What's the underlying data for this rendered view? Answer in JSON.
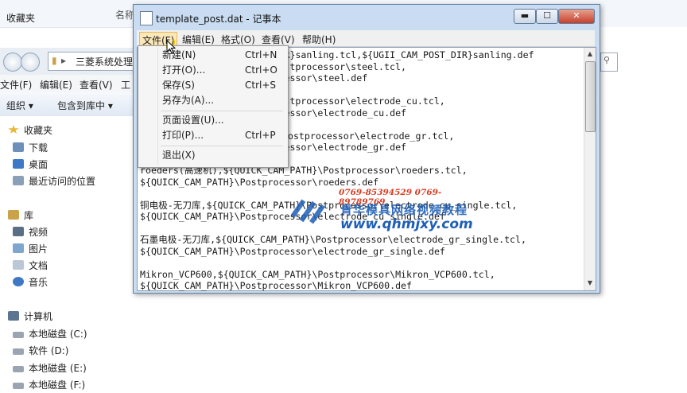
{
  "explorer": {
    "favorites_top": "收藏夹",
    "column_name": "名称",
    "address_path": "三菱系统处理",
    "menu": [
      "文件(F)",
      "编辑(E)",
      "查看(V)",
      "工"
    ],
    "toolbar": {
      "organize": "组织 ▾",
      "include_in_library": "包含到库中 ▾"
    },
    "sidebar": [
      {
        "label": "收藏夹",
        "icon": "star-icon",
        "y": 0
      },
      {
        "label": "下载",
        "icon": "download-folder-icon",
        "y": 1
      },
      {
        "label": "桌面",
        "icon": "desktop-icon",
        "y": 2
      },
      {
        "label": "最近访问的位置",
        "icon": "recent-places-icon",
        "y": 3
      }
    ],
    "libraries": {
      "title": "库",
      "items": [
        "视频",
        "图片",
        "文档",
        "音乐"
      ]
    },
    "computer": {
      "title": "计算机",
      "drives": [
        "本地磁盘 (C:)",
        "软件 (D:)",
        "本地磁盘 (E:)",
        "本地磁盘 (F:)"
      ]
    }
  },
  "notepad": {
    "title": "template_post.dat - 记事本",
    "menu": [
      "文件(F)",
      "编辑(E)",
      "格式(O)",
      "查看(V)",
      "帮助(H)"
    ],
    "window_buttons": {
      "minimize": "▬",
      "maximize": "☐",
      "close": "✕"
    },
    "content": "sanling,${UGII_CAM_POST_DIR}sanling.tcl,${UGII_CAM_POST_DIR}sanling.def\n高速钢,${QUICK_CAM_PATH}\\Postprocessor\\steel.tcl,\n${QUICK_CAM_PATH}\\Postprocessor\\steel.def\n\n铜电极,${QUICK_CAM_PATH}\\Postprocessor\\electrode_cu.tcl,\n${QUICK_CAM_PATH}\\Postprocessor\\electrode_cu.def\n\n石墨电极,${QUICK_CAM_PATH}\\Postprocessor\\electrode_gr.tcl,\n${QUICK_CAM_PATH}\\Postprocessor\\electrode_gr.def\n\nroeders(高速机),${QUICK_CAM_PATH}\\Postprocessor\\roeders.tcl,\n${QUICK_CAM_PATH}\\Postprocessor\\roeders.def\n\n铜电极-无刀库,${QUICK_CAM_PATH}\\Postprocessor\\electrode_cu_single.tcl,\n${QUICK_CAM_PATH}\\Postprocessor\\electrode_cu_single.def\n\n石墨电极-无刀库,${QUICK_CAM_PATH}\\Postprocessor\\electrode_gr_single.tcl,\n${QUICK_CAM_PATH}\\Postprocessor\\electrode_gr_single.def\n\nMikron_VCP600,${QUICK_CAM_PATH}\\Postprocessor\\Mikron_VCP600.tcl,\n${QUICK_CAM_PATH}\\Postprocessor\\Mikron_VCP600.def"
  },
  "file_menu": {
    "groups": [
      [
        {
          "label": "新建(N)",
          "shortcut": "Ctrl+N"
        },
        {
          "label": "打开(O)...",
          "shortcut": "Ctrl+O"
        },
        {
          "label": "保存(S)",
          "shortcut": "Ctrl+S"
        },
        {
          "label": "另存为(A)...",
          "shortcut": ""
        }
      ],
      [
        {
          "label": "页面设置(U)...",
          "shortcut": ""
        },
        {
          "label": "打印(P)...",
          "shortcut": "Ctrl+P"
        }
      ],
      [
        {
          "label": "退出(X)",
          "shortcut": ""
        }
      ]
    ]
  },
  "watermark": {
    "phone": "0769-85394529  0769-89789769",
    "name": "青华模具网络视频教程",
    "url": "www.qhmjxy.com",
    "color_blue": "#1d5fb8",
    "color_red": "#d83b22"
  }
}
